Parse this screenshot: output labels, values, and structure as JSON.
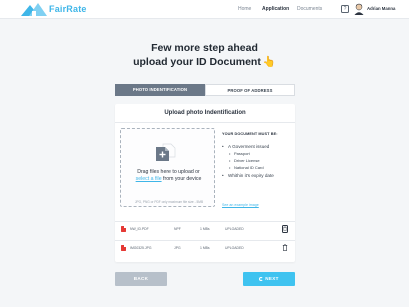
{
  "app": {
    "brand": "FairRate"
  },
  "nav": {
    "home": "Home",
    "application": "Application",
    "documents": "Documents"
  },
  "header": {
    "help": "?",
    "user_name": "Adrian Manna"
  },
  "headline": {
    "line1": "Few more step ahead",
    "line2": "upload your ID Document",
    "emoji": "👆"
  },
  "tabs": [
    {
      "label": "PHOTO INDENTIFICATION",
      "active": true
    },
    {
      "label": "PROOF OF ADDRESS",
      "active": false
    }
  ],
  "card": {
    "title": "Upload photo Indentification",
    "dropzone": {
      "line1": "Drag files here to upload or",
      "link": "select a file",
      "line2_suffix": " from your device",
      "note": "JPG, PNG or PDF only maximum file size - 5MB"
    },
    "requirements": {
      "title": "YOUR DOCUMENT MUST BE:",
      "bullet1": "A Goverment issued",
      "subitems": [
        "Passport",
        "Driver License",
        "National ID Card"
      ],
      "bullet2": "Whithin it's expiry date",
      "example_link": "See an example image"
    },
    "files": [
      {
        "name": "NW_ID.PDF",
        "type": "NPF",
        "size": "1 MBs",
        "status": "UPLOADED"
      },
      {
        "name": "IMG0325.JPG",
        "type": "JPG",
        "size": "1 MBs",
        "status": "UPLOADED"
      }
    ]
  },
  "buttons": {
    "back": "BACK",
    "next": "NEXT"
  },
  "colors": {
    "accent": "#3fb6e8",
    "next_button": "#3fc3f0",
    "active_tab": "#6b7888",
    "back_button": "#b7c0ca",
    "pdf_icon": "#e53935"
  }
}
